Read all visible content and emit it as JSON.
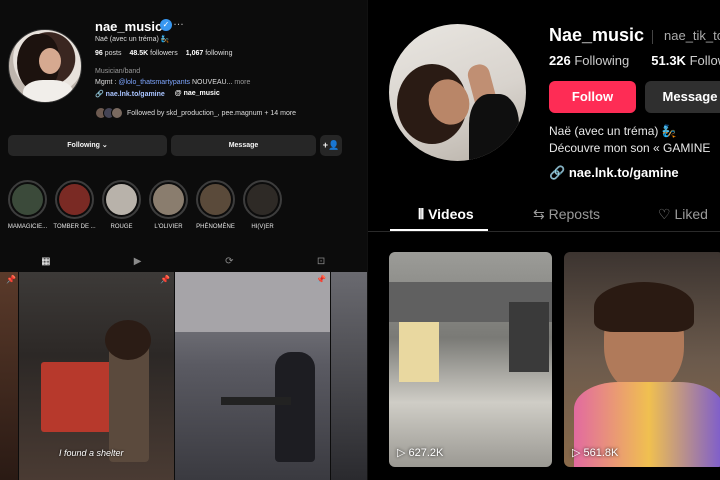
{
  "instagram": {
    "username": "nae_music",
    "more_icon": "…",
    "display_name": "Naë (avec un tréma) 🧞",
    "stats": {
      "posts": "96",
      "posts_label": "posts",
      "followers": "48.5K",
      "followers_label": "followers",
      "following": "1,067",
      "following_label": "following"
    },
    "category": "Musician/band",
    "mgmt_prefix": "Mgmt : ",
    "mgmt_mention": "@lolo_thatsmartypants",
    "mgmt_suffix": " NOUVEAU...",
    "mgmt_more": " more",
    "link": "nae.lnk.to/gamine",
    "threads_handle": "nae_music",
    "followed_by": "Followed by skd_production_, pee.magnum + 14 more",
    "buttons": {
      "following": "Following ⌄",
      "message": "Message",
      "add_user": "+👤"
    },
    "highlights": [
      {
        "label": "MAMAGICIE...",
        "color": "#3b4a3a"
      },
      {
        "label": "TOMBER DE ...",
        "color": "#7a2a24"
      },
      {
        "label": "ROUGE",
        "color": "#b8b2aa"
      },
      {
        "label": "L'OLIVIER",
        "color": "#8a7d6e"
      },
      {
        "label": "PHÉNOMÈNE",
        "color": "#5a4a3a"
      },
      {
        "label": "HI(V)ER",
        "color": "#2e2a26"
      }
    ],
    "tabs": {
      "grid": "▦",
      "reels": "▶",
      "reposts": "⟳",
      "tagged": "⊡"
    },
    "post_caption": "I found a shelter"
  },
  "tiktok": {
    "username": "Nae_music",
    "handle": "nae_tik_to",
    "stats": {
      "following": "226",
      "following_label": "Following",
      "followers": "51.3K",
      "followers_label": "Followers"
    },
    "follow_label": "Follow",
    "message_label": "Message",
    "bio_line1": "Naë (avec un tréma) 🧞",
    "bio_line2": "Découvre mon son « GAMINE",
    "link": "nae.lnk.to/gamine",
    "tabs": {
      "videos": "Videos",
      "reposts": "Reposts",
      "liked": "Liked"
    },
    "videos": [
      {
        "views": "627.2K"
      },
      {
        "views": "561.8K"
      }
    ],
    "accent_color": "#fe2c55"
  }
}
